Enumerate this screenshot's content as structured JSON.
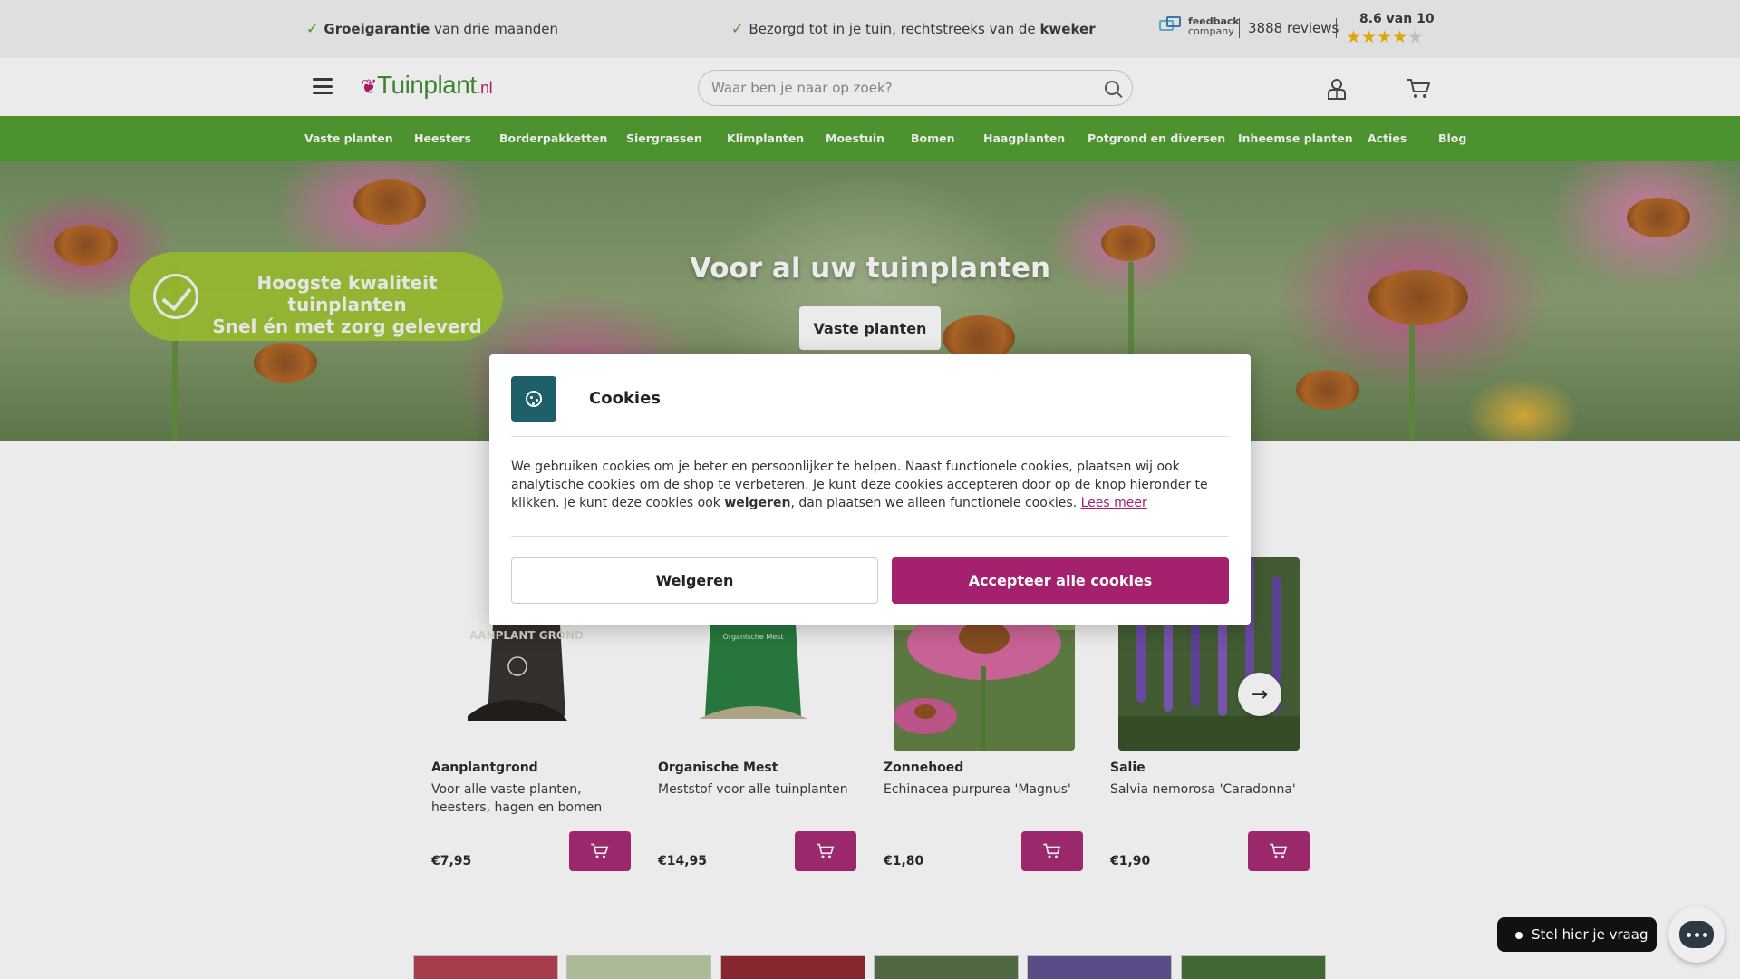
{
  "usp": {
    "item1_bold": "Groeigarantie",
    "item1_rest": " van drie maanden",
    "item2_rest": "Bezorgd tot in je tuin, rechtstreeks van de ",
    "item2_bold": "kweker",
    "feedback_line1": "feedback",
    "feedback_line2": "company",
    "reviews": "3888 reviews",
    "rating": "8.6 van 10",
    "stars": 4.5
  },
  "header": {
    "logo_main": "Tuinplant",
    "logo_suffix": ".nl",
    "search_placeholder": "Waar ben je naar op zoek?",
    "icons": [
      "menu-icon",
      "search-icon",
      "account-icon",
      "cart-icon"
    ]
  },
  "nav": {
    "items": [
      "Vaste planten",
      "Heesters",
      "Borderpakketten",
      "Siergrassen",
      "Klimplanten",
      "Moestuin",
      "Bomen",
      "Haagplanten",
      "Potgrond en diversen",
      "Inheemse planten",
      "Acties",
      "Blog"
    ]
  },
  "hero": {
    "badge_line1": "Hoogste kwaliteit tuinplanten",
    "badge_line2": "Snel én met zorg geleverd",
    "title": "Voor al uw tuinplanten",
    "button": "Vaste planten"
  },
  "products": [
    {
      "name": "Aanplantgrond",
      "desc": "Voor alle vaste planten, heesters, hagen en bomen",
      "price": "€7,95",
      "image_text": "AANPLANT GROND"
    },
    {
      "name": "Organische Mest",
      "desc": "Meststof voor alle tuinplanten",
      "price": "€14,95",
      "image_text": "Organische Mest"
    },
    {
      "name": "Zonnehoed",
      "desc": "Echinacea purpurea 'Magnus'",
      "price": "€1,80"
    },
    {
      "name": "Salie",
      "desc": "Salvia nemorosa 'Caradonna'",
      "price": "€1,90"
    }
  ],
  "cookie": {
    "title": "Cookies",
    "body_part1": "We gebruiken cookies om je beter en persoonlijker te helpen. Naast functionele cookies, plaatsen wij ook analytische cookies om de shop te verbeteren. Je kunt deze cookies accepteren door op de knop hieronder te klikken. Je kunt deze cookies ook ",
    "body_bold": "weigeren",
    "body_part2": ", dan plaatsen we alleen functionele cookies. ",
    "read_more": "Lees meer",
    "refuse": "Weigeren",
    "accept": "Accepteer alle cookies"
  },
  "chat": {
    "label": "Stel hier je vraag"
  },
  "colors": {
    "brand_green": "#4a9a2a",
    "brand_purple": "#a3216d",
    "badge_lime": "#9dc42a",
    "cookie_icon_bg": "#1e5f6a"
  }
}
